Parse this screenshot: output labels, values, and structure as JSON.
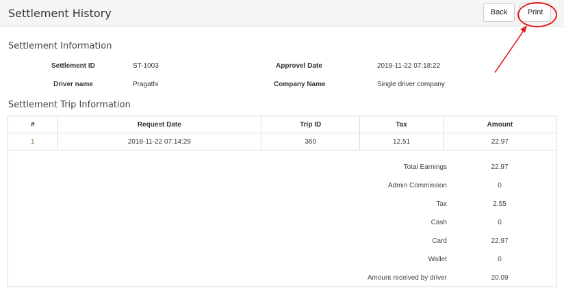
{
  "header": {
    "title": "Settlement History",
    "back_label": "Back",
    "print_label": "Print"
  },
  "settlement_info": {
    "title": "Settlement Information",
    "fields": [
      {
        "label": "Settlement ID",
        "value": "ST-1003"
      },
      {
        "label": "Approvel Date",
        "value": "2018-11-22 07:18:22"
      },
      {
        "label": "Driver name",
        "value": "Pragathi"
      },
      {
        "label": "Company Name",
        "value": "Single driver company"
      }
    ]
  },
  "trip_info": {
    "title": "Settlement Trip Information",
    "columns": [
      "#",
      "Request Date",
      "Trip ID",
      "Tax",
      "Amount"
    ],
    "rows": [
      {
        "index": "1",
        "request_date": "2018-11-22 07:14:29",
        "trip_id": "360",
        "tax": "12.51",
        "amount": "22.97"
      }
    ]
  },
  "summary": [
    {
      "label": "Total Earnings",
      "value": "22.97"
    },
    {
      "label": "Admin Commission",
      "value": "0"
    },
    {
      "label": "Tax",
      "value": "2.55"
    },
    {
      "label": "Cash",
      "value": "0"
    },
    {
      "label": "Card",
      "value": "22.97"
    },
    {
      "label": "Wallet",
      "value": "0"
    },
    {
      "label": "Amount received by driver",
      "value": "20.09"
    }
  ],
  "annotation": {
    "color": "#e0201e"
  }
}
